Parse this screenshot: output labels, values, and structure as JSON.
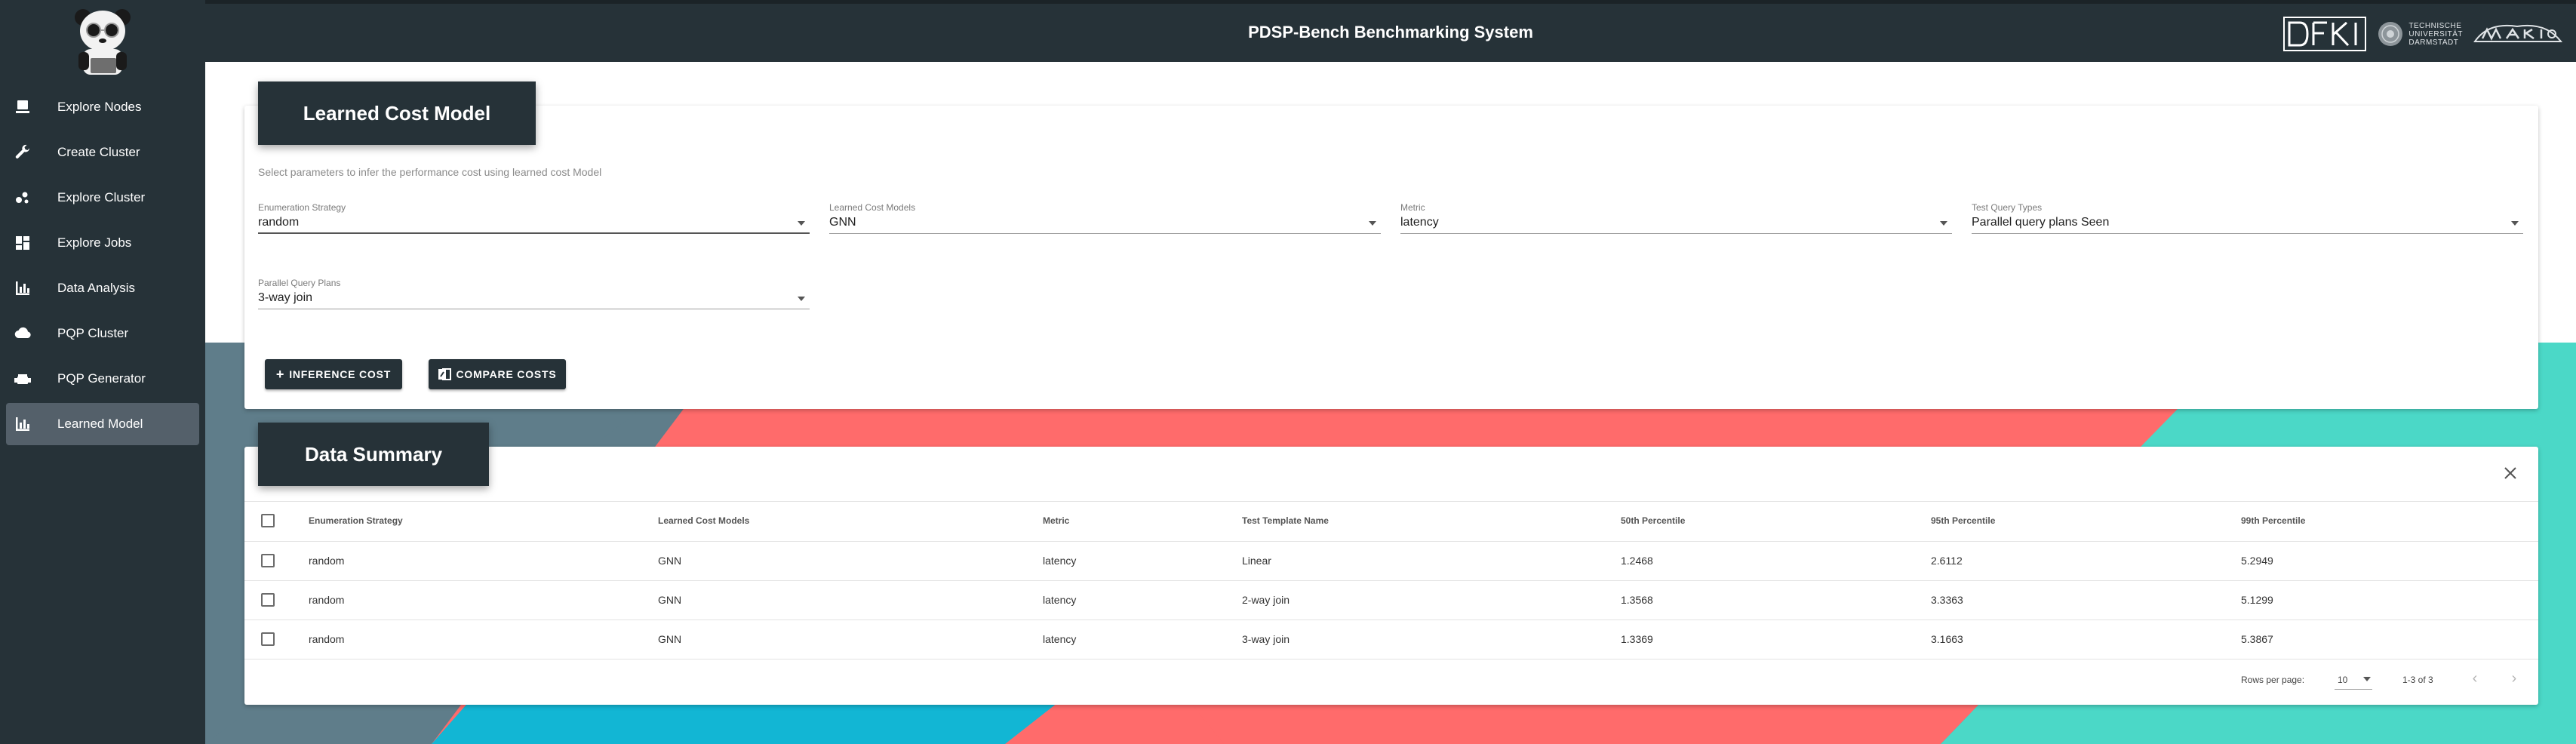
{
  "app": {
    "title": "PDSP-Bench Benchmarking System"
  },
  "header_logos": {
    "university_lines": [
      "TECHNISCHE",
      "UNIVERSITÄT",
      "DARMSTADT"
    ]
  },
  "sidebar": {
    "items": [
      {
        "label": "Explore Nodes",
        "icon": "computer-icon"
      },
      {
        "label": "Create Cluster",
        "icon": "wrench-icon"
      },
      {
        "label": "Explore Cluster",
        "icon": "scatter-icon"
      },
      {
        "label": "Explore Jobs",
        "icon": "dashboard-icon"
      },
      {
        "label": "Data Analysis",
        "icon": "bar-chart-icon"
      },
      {
        "label": "PQP Cluster",
        "icon": "cloud-icon"
      },
      {
        "label": "PQP Generator",
        "icon": "engine-icon"
      },
      {
        "label": "Learned Model",
        "icon": "bar-chart-icon",
        "active": true
      }
    ]
  },
  "learned_cost_model": {
    "title": "Learned Cost Model",
    "subtitle": "Select parameters to infer the performance cost using learned cost Model",
    "fields": [
      {
        "label": "Enumeration Strategy",
        "value": "random"
      },
      {
        "label": "Learned Cost Models",
        "value": "GNN"
      },
      {
        "label": "Metric",
        "value": "latency"
      },
      {
        "label": "Test Query Types",
        "value": "Parallel query plans Seen"
      },
      {
        "label": "Parallel Query Plans",
        "value": "3-way join"
      }
    ],
    "buttons": {
      "inference": "INFERENCE COST",
      "compare": "COMPARE COSTS"
    }
  },
  "data_summary": {
    "title": "Data Summary",
    "columns": [
      "Enumeration Strategy",
      "Learned Cost Models",
      "Metric",
      "Test Template Name",
      "50th Percentile",
      "95th Percentile",
      "99th Percentile"
    ],
    "rows": [
      [
        "random",
        "GNN",
        "latency",
        "Linear",
        "1.2468",
        "2.6112",
        "5.2949"
      ],
      [
        "random",
        "GNN",
        "latency",
        "2-way join",
        "1.3568",
        "3.3363",
        "5.1299"
      ],
      [
        "random",
        "GNN",
        "latency",
        "3-way join",
        "1.3369",
        "3.1663",
        "5.3867"
      ]
    ],
    "pagination": {
      "rows_per_page_label": "Rows per page:",
      "rows_per_page": "10",
      "range": "1-3 of 3"
    }
  },
  "colors": {
    "dark": "#263238",
    "coral": "#ff6b6b",
    "teal": "#4dd9c7",
    "slate": "#607d8b",
    "cyan": "#12b7d4"
  }
}
